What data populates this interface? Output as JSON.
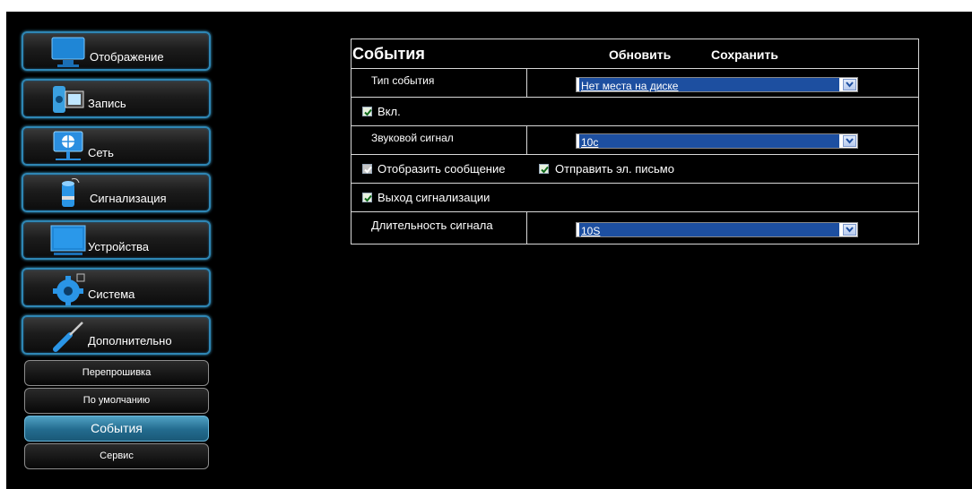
{
  "sidebar": {
    "menu": [
      {
        "label": "Отображение",
        "icon": "monitor-icon"
      },
      {
        "label": "Запись",
        "icon": "film-icon"
      },
      {
        "label": "Сеть",
        "icon": "network-icon"
      },
      {
        "label": "Сигнализация",
        "icon": "alarm-icon"
      },
      {
        "label": "Устройства",
        "icon": "display-device-icon"
      },
      {
        "label": "Система",
        "icon": "gear-icon"
      },
      {
        "label": "Дополнительно",
        "icon": "screwdriver-icon"
      }
    ],
    "submenu": [
      {
        "label": "Перепрошивка",
        "active": false
      },
      {
        "label": "По умолчанию",
        "active": false
      },
      {
        "label": "События",
        "active": true
      },
      {
        "label": "Сервис",
        "active": false
      }
    ]
  },
  "panel": {
    "title": "События",
    "refresh_label": "Обновить",
    "save_label": "Сохранить",
    "event_type": {
      "label": "Тип события",
      "value": "Нет места на диске"
    },
    "enable": {
      "label": "Вкл.",
      "checked": true
    },
    "buzzer": {
      "label": "Звуковой сигнал",
      "value": "10с"
    },
    "show_message": {
      "label": "Отобразить сообщение",
      "checked": true
    },
    "send_email": {
      "label": "Отправить эл. письмо",
      "checked": true
    },
    "alarm_output": {
      "label": "Выход сигнализации",
      "checked": true
    },
    "duration": {
      "label": "Длительность сигнала",
      "value": "10S"
    }
  },
  "colors": {
    "accent": "#2e86b4",
    "active_submenu": "#236b8e",
    "select_highlight": "#1d4fa0"
  }
}
